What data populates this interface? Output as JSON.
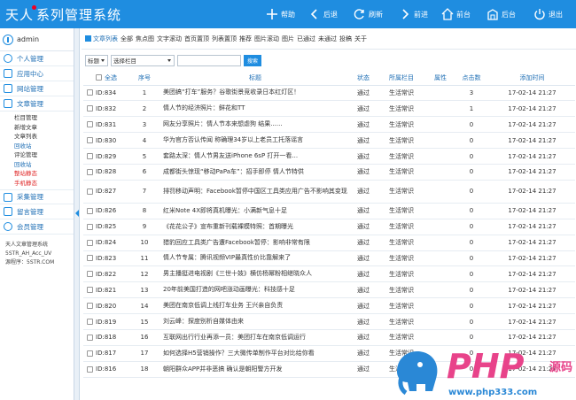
{
  "header": {
    "title": "天人系列管理系统",
    "nav": [
      {
        "label": "帮助",
        "icon": "plus-icon"
      },
      {
        "label": "后退",
        "icon": "chevron-left-icon"
      },
      {
        "label": "刷新",
        "icon": "refresh-icon"
      },
      {
        "label": "前进",
        "icon": "chevron-right-icon"
      },
      {
        "label": "前台",
        "icon": "home-icon"
      },
      {
        "label": "后台",
        "icon": "building-icon"
      },
      {
        "label": "退出",
        "icon": "power-icon"
      }
    ]
  },
  "sidebar": {
    "user": "admin",
    "menus": [
      {
        "label": "个人管理",
        "icon": "user-icon"
      },
      {
        "label": "应用中心",
        "icon": "app-icon"
      },
      {
        "label": "网站管理",
        "icon": "site-icon"
      },
      {
        "label": "文章管理",
        "icon": "article-icon"
      }
    ],
    "subitems": [
      {
        "label": "栏目管理",
        "style": "normal"
      },
      {
        "label": "新增文章",
        "style": "normal"
      },
      {
        "label": "文章列表",
        "style": "normal"
      },
      {
        "label": "回收站",
        "style": "blue"
      },
      {
        "label": "评论管理",
        "style": "normal"
      },
      {
        "label": "回收站",
        "style": "blue"
      },
      {
        "label": "整站静态",
        "style": "red"
      },
      {
        "label": "手机静态",
        "style": "red"
      }
    ],
    "menus2": [
      {
        "label": "采集管理",
        "icon": "collect-icon"
      },
      {
        "label": "留言管理",
        "icon": "message-icon"
      },
      {
        "label": "会员管理",
        "icon": "member-icon"
      }
    ],
    "sysinfo": [
      "天人文章管理系统",
      "5STR_AH_Acc_UV",
      "源程序：5STR.COM"
    ]
  },
  "breadcrumb": {
    "current": "文章列表",
    "items": [
      "全部",
      "焦点图",
      "文字滚动",
      "首页置顶",
      "列表置顶",
      "推荐",
      "图片滚动",
      "图片",
      "已通过",
      "未通过",
      "投稿",
      "关于"
    ]
  },
  "filter": {
    "field_select": "标题",
    "category_select": "选择栏目",
    "keyword": "",
    "search_button": "搜索"
  },
  "table": {
    "headers": [
      "全选",
      "序号",
      "标题",
      "状态",
      "所属栏目",
      "属性",
      "点击数",
      "添加时间"
    ],
    "rows": [
      {
        "id": "ID:834",
        "no": "1",
        "title": "美团搞“打车”服务？谷歌街景竞收录日本红灯区！",
        "status": "通过",
        "category": "生活常识",
        "attr": "",
        "clicks": "3",
        "time": "17-02-14 21:27"
      },
      {
        "id": "ID:832",
        "no": "2",
        "title": "情人节的经济照片：鲜花和TT",
        "status": "通过",
        "category": "生活常识",
        "attr": "",
        "clicks": "1",
        "time": "17-02-14 21:27"
      },
      {
        "id": "ID:831",
        "no": "3",
        "title": "网友分享照片：情人节本来想虐狗 结果......",
        "status": "通过",
        "category": "生活常识",
        "attr": "",
        "clicks": "0",
        "time": "17-02-14 21:27"
      },
      {
        "id": "ID:830",
        "no": "4",
        "title": "华为官方否认传闻 称确理34岁以上老员工托落谣言",
        "status": "通过",
        "category": "生活常识",
        "attr": "",
        "clicks": "0",
        "time": "17-02-14 21:27"
      },
      {
        "id": "ID:829",
        "no": "5",
        "title": "套路太深：情人节男友送iPhone 6sP 打开一看...",
        "status": "通过",
        "category": "生活常识",
        "attr": "",
        "clicks": "0",
        "time": "17-02-14 21:27"
      },
      {
        "id": "ID:828",
        "no": "6",
        "title": "成都街头惊现“移动PaPa车”：招手即停 情人节特供",
        "status": "通过",
        "category": "生活常识",
        "attr": "",
        "clicks": "0",
        "time": "17-02-14 21:27"
      },
      {
        "id": "ID:827",
        "no": "7",
        "title": "排罚移动声明：Facebook暂停中国区工具类应用广告不影响其变现",
        "status": "通过",
        "category": "生活常识",
        "attr": "",
        "clicks": "0",
        "time": "17-02-14 21:27",
        "tall": true
      },
      {
        "id": "ID:826",
        "no": "8",
        "title": "红米Note 4X即将真机曝光：小满新气息十足",
        "status": "通过",
        "category": "生活常识",
        "attr": "",
        "clicks": "0",
        "time": "17-02-14 21:27"
      },
      {
        "id": "ID:825",
        "no": "9",
        "title": "《花花公子》宣布重新刊载裸模特照：首期曝光",
        "status": "通过",
        "category": "生活常识",
        "attr": "",
        "clicks": "0",
        "time": "17-02-14 21:27"
      },
      {
        "id": "ID:824",
        "no": "10",
        "title": "猎豹回应工具类广告遭Facebook暂停：影响非常有限",
        "status": "通过",
        "category": "生活常识",
        "attr": "",
        "clicks": "0",
        "time": "17-02-14 21:27"
      },
      {
        "id": "ID:823",
        "no": "11",
        "title": "情人节专属：腾讯视频VIP最真性价比靠解来了",
        "status": "通过",
        "category": "生活常识",
        "attr": "",
        "clicks": "0",
        "time": "17-02-14 21:27"
      },
      {
        "id": "ID:822",
        "no": "12",
        "title": "男主播挺进电视剧《三世十妓》横仿杨幂粉相继晓众人",
        "status": "通过",
        "category": "生活常识",
        "attr": "",
        "clicks": "0",
        "time": "17-02-14 21:27"
      },
      {
        "id": "ID:821",
        "no": "13",
        "title": "20年前美国打造的网吧涨动画曝光：科技感十足",
        "status": "通过",
        "category": "生活常识",
        "attr": "",
        "clicks": "0",
        "time": "17-02-14 21:27"
      },
      {
        "id": "ID:820",
        "no": "14",
        "title": "美团在南京低调上线打车业务 王兴亲自负责",
        "status": "通过",
        "category": "生活常识",
        "attr": "",
        "clicks": "0",
        "time": "17-02-14 21:27"
      },
      {
        "id": "ID:819",
        "no": "15",
        "title": "刘云峰：探度别析自媒体由来",
        "status": "通过",
        "category": "生活常识",
        "attr": "",
        "clicks": "0",
        "time": "17-02-14 21:27"
      },
      {
        "id": "ID:818",
        "no": "16",
        "title": "互联网出行行业再添一员：美团打车在南京低调运行",
        "status": "通过",
        "category": "生活常识",
        "attr": "",
        "clicks": "0",
        "time": "17-02-14 21:27"
      },
      {
        "id": "ID:817",
        "no": "17",
        "title": "如何选择H5营销操作？三大微传单制作平台对比给你看",
        "status": "通过",
        "category": "生活常识",
        "attr": "",
        "clicks": "0",
        "time": "17-02-14 21:27"
      },
      {
        "id": "ID:816",
        "no": "18",
        "title": "朝阳群众APP并非恶搞 确认是朝阳警方开发",
        "status": "通过",
        "category": "生活常识",
        "attr": "",
        "clicks": "0",
        "time": "17-02-14 21:27"
      }
    ]
  },
  "watermark": {
    "brand": "PHP",
    "code": "源码",
    "url": "www.php333.com"
  }
}
